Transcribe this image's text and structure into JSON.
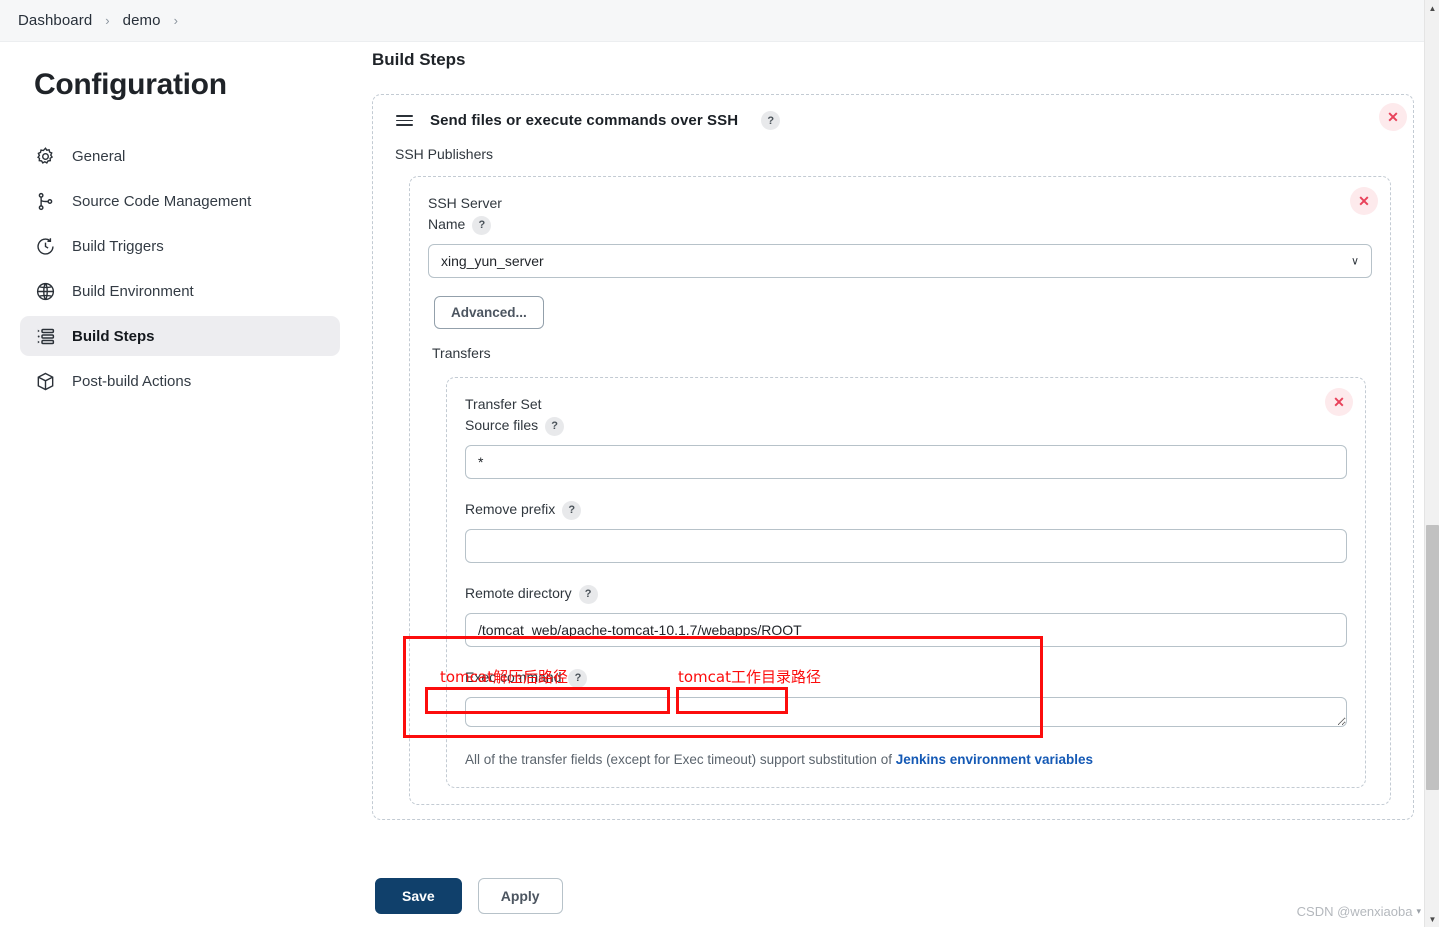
{
  "breadcrumb": {
    "items": [
      "Dashboard",
      "demo"
    ],
    "separator": "›"
  },
  "sidebar": {
    "title": "Configuration",
    "items": [
      {
        "label": "General",
        "icon": "gear-icon",
        "active": false
      },
      {
        "label": "Source Code Management",
        "icon": "branch-icon",
        "active": false
      },
      {
        "label": "Build Triggers",
        "icon": "clock-icon",
        "active": false
      },
      {
        "label": "Build Environment",
        "icon": "globe-icon",
        "active": false
      },
      {
        "label": "Build Steps",
        "icon": "list-icon",
        "active": true
      },
      {
        "label": "Post-build Actions",
        "icon": "box-icon",
        "active": false
      }
    ]
  },
  "main": {
    "page_title": "Build Steps",
    "step": {
      "title": "Send files or execute commands over SSH",
      "help": "?",
      "close": "✕",
      "publishers_label": "SSH Publishers",
      "server": {
        "label_line1": "SSH Server",
        "label_line2": "Name",
        "help": "?",
        "close": "✕",
        "selected": "xing_yun_server",
        "chevron": "∨",
        "advanced_label": "Advanced...",
        "transfers_label": "Transfers"
      },
      "transfer_set": {
        "title": "Transfer Set",
        "close": "✕",
        "source_files": {
          "label": "Source files",
          "help": "?",
          "value": "*",
          "placeholder": ""
        },
        "remove_prefix": {
          "label": "Remove prefix",
          "help": "?",
          "value": "",
          "placeholder": ""
        },
        "remote_directory": {
          "label": "Remote directory",
          "help": "?",
          "value": "/tomcat_web/apache-tomcat-10.1.7/webapps/ROOT",
          "placeholder": ""
        },
        "exec_command": {
          "label": "Exec command",
          "help": "?",
          "value": "",
          "placeholder": ""
        },
        "note_prefix": "All of the transfer fields (except for Exec timeout) support substitution of ",
        "note_link": "Jenkins environment variables"
      }
    }
  },
  "annotations": {
    "color": "#fc0d0d",
    "label_left": "tomcat解压后路径",
    "label_right": "tomcat工作目录路径"
  },
  "footer": {
    "save_label": "Save",
    "apply_label": "Apply",
    "save_color": "#10406b"
  },
  "watermark": {
    "text": "CSDN @wenxiaoba",
    "caret": "▾"
  },
  "scrollbar": {
    "up_arrow": "▲",
    "down_arrow": "▼"
  }
}
